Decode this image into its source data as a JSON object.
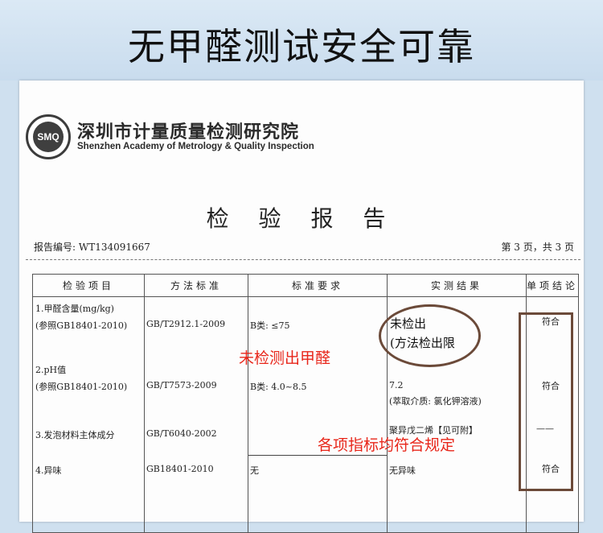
{
  "banner": {
    "title": "无甲醛测试安全可靠"
  },
  "institution": {
    "logo_text": "SMQ",
    "name_cn": "深圳市计量质量检测研究院",
    "name_en": "Shenzhen Academy of Metrology & Quality Inspection"
  },
  "report": {
    "title": "检 验 报 告",
    "number": "报告编号: WT134091667",
    "page": "第 3 页，共 3 页"
  },
  "table": {
    "headers": [
      "检验项目",
      "方法标准",
      "标准要求",
      "实测结果",
      "单项结论"
    ],
    "items": [
      {
        "name": "1.甲醛含量(mg/kg)",
        "ref": "(参照GB18401-2010)",
        "method": "GB/T2912.1-2009",
        "requirement": "B类: ≤75",
        "result": "未检出",
        "result_note": "(方法检出限",
        "conclusion": "符合"
      },
      {
        "name": "2.pH值",
        "ref": "(参照GB18401-2010)",
        "method": "GB/T7573-2009",
        "requirement": "B类: 4.0~8.5",
        "result": "7.2",
        "result_note": "(萃取介质: 氯化钾溶液)",
        "conclusion": "符合"
      },
      {
        "name": "3.发泡材料主体成分",
        "method": "GB/T6040-2002",
        "requirement": "——",
        "result": "聚异戊二烯【见可附】",
        "conclusion": "——"
      },
      {
        "name": "4.异味",
        "method": "GB18401-2010",
        "requirement": "无",
        "result": "无异味",
        "conclusion": "符合"
      }
    ]
  },
  "annotations": {
    "no_formaldehyde": "未检测出甲醛",
    "all_compliant": "各项指标均符合规定"
  },
  "colors": {
    "annotation_red": "#e8261a",
    "marker_brown": "#6b4a39",
    "background": "#cfe0ef"
  }
}
